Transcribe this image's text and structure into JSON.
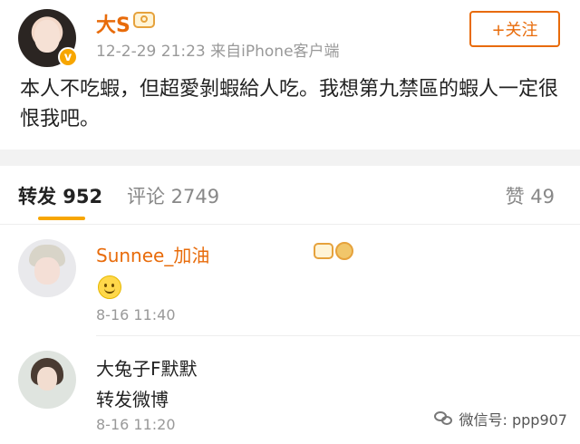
{
  "post": {
    "author_name": "大S",
    "meta": "12-2-29 21:23  来自iPhone客户端",
    "follow_label": "+关注",
    "vip_badge": "v",
    "text": "本人不吃蝦，但超愛剝蝦給人吃。我想第九禁區的蝦人一定很恨我吧。"
  },
  "tabs": {
    "repost": "转发 952",
    "comment": "评论 2749",
    "like": "赞 49",
    "active_color": "#f7a600"
  },
  "comments": [
    {
      "name": "Sunnee_加油",
      "name_color": "#e86b0a",
      "content_emoji": "smile",
      "time": "8-16 11:40"
    },
    {
      "name": "大兔子F默默",
      "name_color": "#222222",
      "content": "转发微博",
      "time": "8-16 11:20"
    }
  ],
  "watermark": {
    "text": "微信号: ppp907"
  },
  "colors": {
    "brand_orange": "#e86b0a",
    "badge_gold": "#e6a23c"
  }
}
